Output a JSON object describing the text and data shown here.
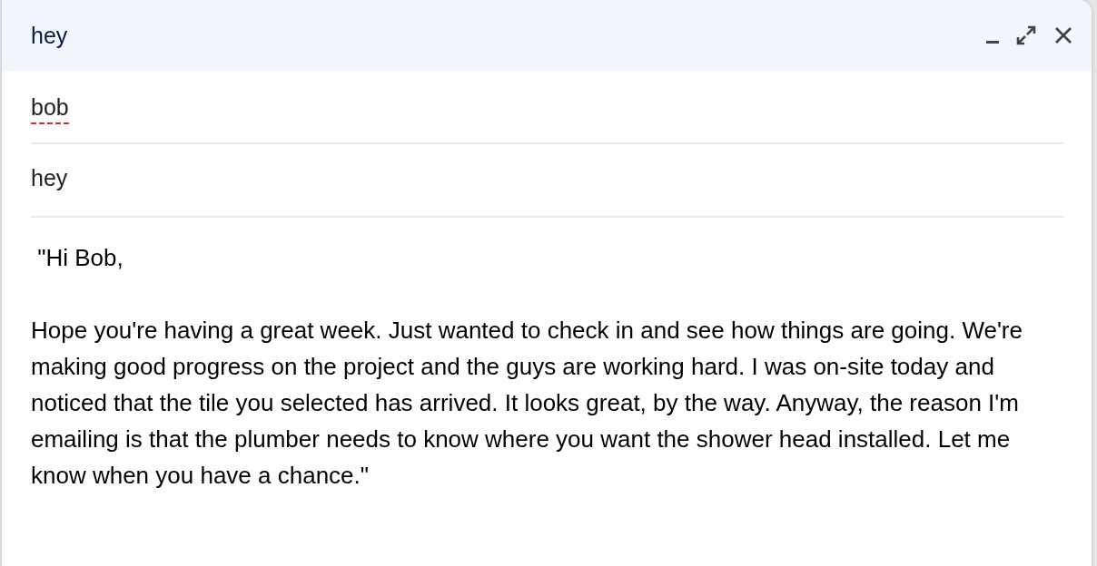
{
  "window": {
    "title": "hey"
  },
  "to": {
    "value": "bob",
    "misspelled": true
  },
  "subject": {
    "value": "hey"
  },
  "body": {
    "paragraphs": [
      " \"Hi Bob,",
      "Hope you're having a great week. Just wanted to check in and see how things are going. We're making good progress on the project and the guys are working hard. I was on-site today and noticed that the tile you selected has arrived. It looks great, by the way. Anyway, the reason I'm emailing is that the plumber needs to know where you want the shower head installed. Let me know when you have a chance.\""
    ]
  }
}
